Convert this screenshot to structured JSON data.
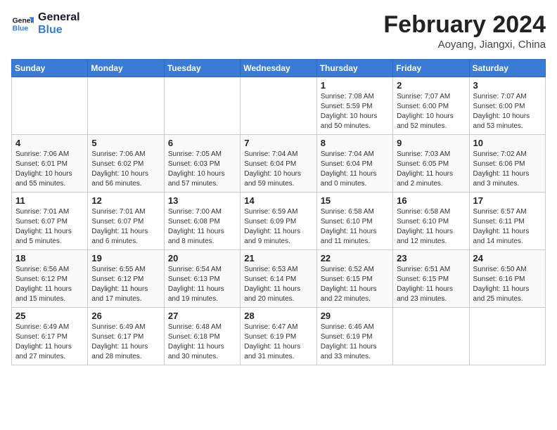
{
  "header": {
    "logo_line1": "General",
    "logo_line2": "Blue",
    "month_title": "February 2024",
    "location": "Aoyang, Jiangxi, China"
  },
  "weekdays": [
    "Sunday",
    "Monday",
    "Tuesday",
    "Wednesday",
    "Thursday",
    "Friday",
    "Saturday"
  ],
  "weeks": [
    [
      {
        "day": "",
        "info": ""
      },
      {
        "day": "",
        "info": ""
      },
      {
        "day": "",
        "info": ""
      },
      {
        "day": "",
        "info": ""
      },
      {
        "day": "1",
        "info": "Sunrise: 7:08 AM\nSunset: 5:59 PM\nDaylight: 10 hours\nand 50 minutes."
      },
      {
        "day": "2",
        "info": "Sunrise: 7:07 AM\nSunset: 6:00 PM\nDaylight: 10 hours\nand 52 minutes."
      },
      {
        "day": "3",
        "info": "Sunrise: 7:07 AM\nSunset: 6:00 PM\nDaylight: 10 hours\nand 53 minutes."
      }
    ],
    [
      {
        "day": "4",
        "info": "Sunrise: 7:06 AM\nSunset: 6:01 PM\nDaylight: 10 hours\nand 55 minutes."
      },
      {
        "day": "5",
        "info": "Sunrise: 7:06 AM\nSunset: 6:02 PM\nDaylight: 10 hours\nand 56 minutes."
      },
      {
        "day": "6",
        "info": "Sunrise: 7:05 AM\nSunset: 6:03 PM\nDaylight: 10 hours\nand 57 minutes."
      },
      {
        "day": "7",
        "info": "Sunrise: 7:04 AM\nSunset: 6:04 PM\nDaylight: 10 hours\nand 59 minutes."
      },
      {
        "day": "8",
        "info": "Sunrise: 7:04 AM\nSunset: 6:04 PM\nDaylight: 11 hours\nand 0 minutes."
      },
      {
        "day": "9",
        "info": "Sunrise: 7:03 AM\nSunset: 6:05 PM\nDaylight: 11 hours\nand 2 minutes."
      },
      {
        "day": "10",
        "info": "Sunrise: 7:02 AM\nSunset: 6:06 PM\nDaylight: 11 hours\nand 3 minutes."
      }
    ],
    [
      {
        "day": "11",
        "info": "Sunrise: 7:01 AM\nSunset: 6:07 PM\nDaylight: 11 hours\nand 5 minutes."
      },
      {
        "day": "12",
        "info": "Sunrise: 7:01 AM\nSunset: 6:07 PM\nDaylight: 11 hours\nand 6 minutes."
      },
      {
        "day": "13",
        "info": "Sunrise: 7:00 AM\nSunset: 6:08 PM\nDaylight: 11 hours\nand 8 minutes."
      },
      {
        "day": "14",
        "info": "Sunrise: 6:59 AM\nSunset: 6:09 PM\nDaylight: 11 hours\nand 9 minutes."
      },
      {
        "day": "15",
        "info": "Sunrise: 6:58 AM\nSunset: 6:10 PM\nDaylight: 11 hours\nand 11 minutes."
      },
      {
        "day": "16",
        "info": "Sunrise: 6:58 AM\nSunset: 6:10 PM\nDaylight: 11 hours\nand 12 minutes."
      },
      {
        "day": "17",
        "info": "Sunrise: 6:57 AM\nSunset: 6:11 PM\nDaylight: 11 hours\nand 14 minutes."
      }
    ],
    [
      {
        "day": "18",
        "info": "Sunrise: 6:56 AM\nSunset: 6:12 PM\nDaylight: 11 hours\nand 15 minutes."
      },
      {
        "day": "19",
        "info": "Sunrise: 6:55 AM\nSunset: 6:12 PM\nDaylight: 11 hours\nand 17 minutes."
      },
      {
        "day": "20",
        "info": "Sunrise: 6:54 AM\nSunset: 6:13 PM\nDaylight: 11 hours\nand 19 minutes."
      },
      {
        "day": "21",
        "info": "Sunrise: 6:53 AM\nSunset: 6:14 PM\nDaylight: 11 hours\nand 20 minutes."
      },
      {
        "day": "22",
        "info": "Sunrise: 6:52 AM\nSunset: 6:15 PM\nDaylight: 11 hours\nand 22 minutes."
      },
      {
        "day": "23",
        "info": "Sunrise: 6:51 AM\nSunset: 6:15 PM\nDaylight: 11 hours\nand 23 minutes."
      },
      {
        "day": "24",
        "info": "Sunrise: 6:50 AM\nSunset: 6:16 PM\nDaylight: 11 hours\nand 25 minutes."
      }
    ],
    [
      {
        "day": "25",
        "info": "Sunrise: 6:49 AM\nSunset: 6:17 PM\nDaylight: 11 hours\nand 27 minutes."
      },
      {
        "day": "26",
        "info": "Sunrise: 6:49 AM\nSunset: 6:17 PM\nDaylight: 11 hours\nand 28 minutes."
      },
      {
        "day": "27",
        "info": "Sunrise: 6:48 AM\nSunset: 6:18 PM\nDaylight: 11 hours\nand 30 minutes."
      },
      {
        "day": "28",
        "info": "Sunrise: 6:47 AM\nSunset: 6:19 PM\nDaylight: 11 hours\nand 31 minutes."
      },
      {
        "day": "29",
        "info": "Sunrise: 6:46 AM\nSunset: 6:19 PM\nDaylight: 11 hours\nand 33 minutes."
      },
      {
        "day": "",
        "info": ""
      },
      {
        "day": "",
        "info": ""
      }
    ]
  ]
}
